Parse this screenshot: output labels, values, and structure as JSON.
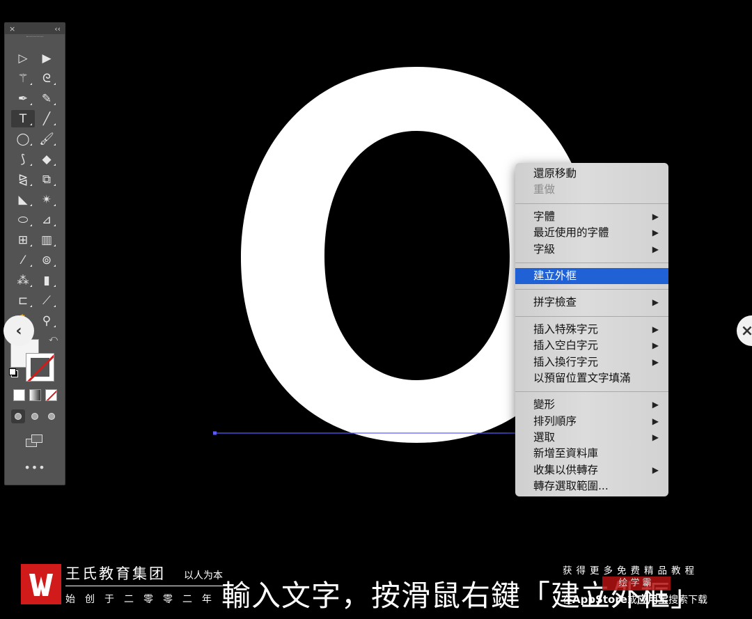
{
  "toolbar": {
    "close_glyph": "×",
    "collapse_glyph": "‹‹",
    "tools": [
      {
        "name": "selection-tool-icon",
        "glyph": "▷"
      },
      {
        "name": "direct-selection-tool-icon",
        "glyph": "▶"
      },
      {
        "name": "magic-wand-tool-icon",
        "glyph": "⚚"
      },
      {
        "name": "lasso-tool-icon",
        "glyph": "ᘓ"
      },
      {
        "name": "pen-tool-icon",
        "glyph": "✒"
      },
      {
        "name": "curvature-tool-icon",
        "glyph": "✎"
      },
      {
        "name": "type-tool-icon",
        "glyph": "T"
      },
      {
        "name": "line-segment-tool-icon",
        "glyph": "╱"
      },
      {
        "name": "ellipse-tool-icon",
        "glyph": "◯"
      },
      {
        "name": "paintbrush-tool-icon",
        "glyph": "🖌"
      },
      {
        "name": "shaper-tool-icon",
        "glyph": "⟆"
      },
      {
        "name": "eraser-tool-icon",
        "glyph": "◆"
      },
      {
        "name": "reflect-tool-icon",
        "glyph": "⧎"
      },
      {
        "name": "scale-tool-icon",
        "glyph": "⧉"
      },
      {
        "name": "width-tool-icon",
        "glyph": "◣"
      },
      {
        "name": "puppet-warp-tool-icon",
        "glyph": "✴"
      },
      {
        "name": "shape-builder-tool-icon",
        "glyph": "⬭"
      },
      {
        "name": "perspective-grid-tool-icon",
        "glyph": "⊿"
      },
      {
        "name": "mesh-tool-icon",
        "glyph": "⊞"
      },
      {
        "name": "gradient-tool-icon",
        "glyph": "▥"
      },
      {
        "name": "eyedropper-tool-icon",
        "glyph": "⁄"
      },
      {
        "name": "blend-tool-icon",
        "glyph": "⊚"
      },
      {
        "name": "symbol-sprayer-tool-icon",
        "glyph": "⁂"
      },
      {
        "name": "column-graph-tool-icon",
        "glyph": "▮"
      },
      {
        "name": "artboard-tool-icon",
        "glyph": "⊏"
      },
      {
        "name": "slice-tool-icon",
        "glyph": "⟋"
      },
      {
        "name": "hand-tool-icon",
        "glyph": "✋"
      },
      {
        "name": "zoom-tool-icon",
        "glyph": "⚲"
      }
    ],
    "more_label": "•••"
  },
  "context_menu": {
    "items": [
      {
        "label": "還原移動",
        "state": "normal",
        "submenu": false,
        "sep_before": false
      },
      {
        "label": "重做",
        "state": "disabled",
        "submenu": false,
        "sep_before": false
      },
      {
        "label": "字體",
        "state": "normal",
        "submenu": true,
        "sep_before": true
      },
      {
        "label": "最近使用的字體",
        "state": "normal",
        "submenu": true,
        "sep_before": false
      },
      {
        "label": "字級",
        "state": "normal",
        "submenu": true,
        "sep_before": false
      },
      {
        "label": "建立外框",
        "state": "highlighted",
        "submenu": false,
        "sep_before": true
      },
      {
        "label": "拼字檢查",
        "state": "normal",
        "submenu": true,
        "sep_before": true
      },
      {
        "label": "插入特殊字元",
        "state": "normal",
        "submenu": true,
        "sep_before": true
      },
      {
        "label": "插入空白字元",
        "state": "normal",
        "submenu": true,
        "sep_before": false
      },
      {
        "label": "插入換行字元",
        "state": "normal",
        "submenu": true,
        "sep_before": false
      },
      {
        "label": "以預留位置文字填滿",
        "state": "normal",
        "submenu": false,
        "sep_before": false
      },
      {
        "label": "變形",
        "state": "normal",
        "submenu": true,
        "sep_before": true
      },
      {
        "label": "排列順序",
        "state": "normal",
        "submenu": true,
        "sep_before": false
      },
      {
        "label": "選取",
        "state": "normal",
        "submenu": true,
        "sep_before": false
      },
      {
        "label": "新增至資料庫",
        "state": "normal",
        "submenu": false,
        "sep_before": false
      },
      {
        "label": "收集以供轉存",
        "state": "normal",
        "submenu": true,
        "sep_before": false
      },
      {
        "label": "轉存選取範圍...",
        "state": "normal",
        "submenu": false,
        "sep_before": false
      }
    ],
    "submenu_glyph": "▶"
  },
  "canvas": {
    "letter": "O",
    "letter_color": "#ffffff",
    "baseline_color": "#5a5aff"
  },
  "navigation": {
    "prev_glyph": "‹",
    "next_glyph": "×"
  },
  "brand": {
    "logo_text": "W",
    "name": "王氏教育集团",
    "slogan": "以人为本",
    "since": "始创于二零零二年"
  },
  "subtitle": "輸入文字，按滑鼠右鍵「建立外框」",
  "promo": {
    "top": "获得更多免费精品教程",
    "badge": "绘学霸",
    "bottom_prefix": "在",
    "app_store": "AppStore",
    "bottom_mid": "或",
    "app_market": "应用宝",
    "bottom_suffix": "搜索下载"
  },
  "colors": {
    "menu_highlight": "#2062d6",
    "brand_red": "#d11a1a",
    "toolbar_bg": "#535353"
  }
}
